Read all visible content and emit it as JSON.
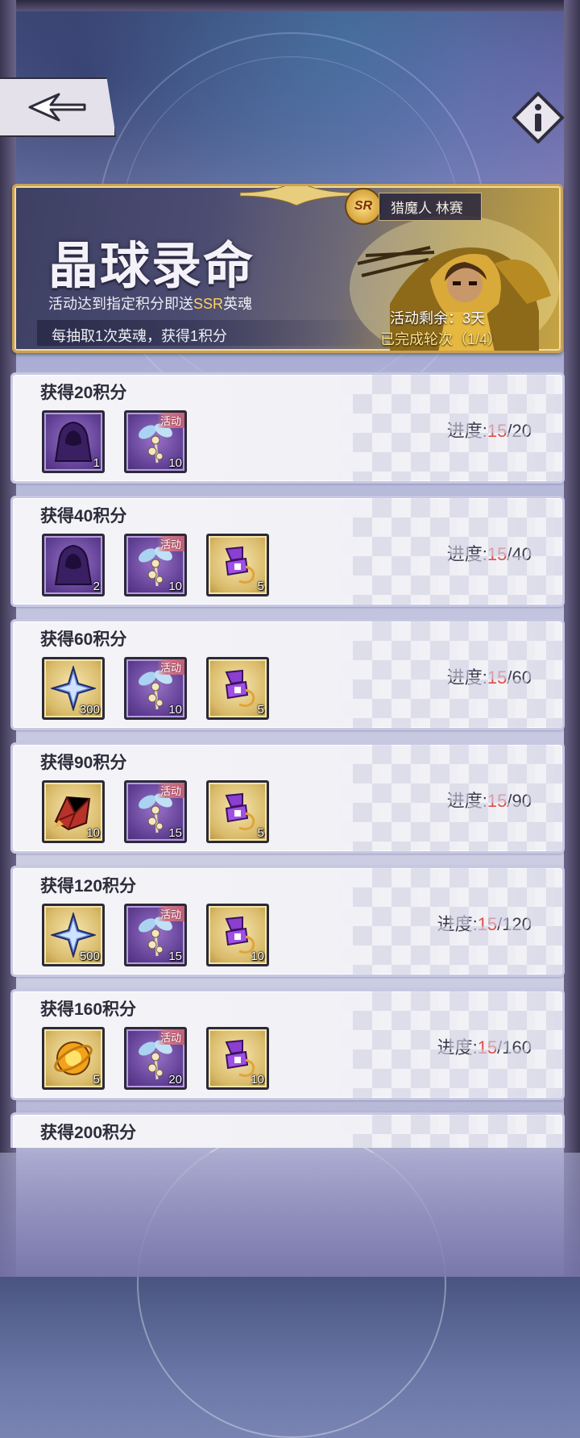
{
  "banner": {
    "title": "晶球录命",
    "desc_prefix": "活动达到指定积分即送",
    "desc_ssr": "SSR",
    "desc_suffix": "英魂",
    "rule": "每抽取1次英魂，获得1积分",
    "ssr_badge": "SR",
    "hero_name": "猎魔人 林赛",
    "remain": "活动剩余：3天",
    "completed": "已完成轮次（1/4）"
  },
  "progress_label": "进度:",
  "tasks": [
    {
      "title": "获得20积分",
      "current": "15",
      "target": "/20",
      "items": [
        {
          "icon": "hooded-figure-icon",
          "bg": "purple",
          "count": "1",
          "event": ""
        },
        {
          "icon": "event-token-icon",
          "bg": "purple",
          "count": "10",
          "event": "活动"
        }
      ]
    },
    {
      "title": "获得40积分",
      "current": "15",
      "target": "/40",
      "items": [
        {
          "icon": "hooded-figure-icon",
          "bg": "purple",
          "count": "2",
          "event": ""
        },
        {
          "icon": "event-token-icon",
          "bg": "purple",
          "count": "10",
          "event": "活动"
        },
        {
          "icon": "purple-ticket-icon",
          "bg": "gold",
          "count": "5",
          "event": ""
        }
      ]
    },
    {
      "title": "获得60积分",
      "current": "15",
      "target": "/60",
      "items": [
        {
          "icon": "blue-crystal-icon",
          "bg": "gold",
          "count": "300",
          "event": ""
        },
        {
          "icon": "event-token-icon",
          "bg": "purple",
          "count": "10",
          "event": "活动"
        },
        {
          "icon": "purple-ticket-icon",
          "bg": "gold",
          "count": "5",
          "event": ""
        }
      ]
    },
    {
      "title": "获得90积分",
      "current": "15",
      "target": "/90",
      "items": [
        {
          "icon": "red-gem-icon",
          "bg": "gold",
          "count": "10",
          "event": ""
        },
        {
          "icon": "event-token-icon",
          "bg": "purple",
          "count": "15",
          "event": "活动"
        },
        {
          "icon": "purple-ticket-icon",
          "bg": "gold",
          "count": "5",
          "event": ""
        }
      ]
    },
    {
      "title": "获得120积分",
      "current": "15",
      "target": "/120",
      "items": [
        {
          "icon": "blue-crystal-icon",
          "bg": "gold",
          "count": "500",
          "event": ""
        },
        {
          "icon": "event-token-icon",
          "bg": "purple",
          "count": "15",
          "event": "活动"
        },
        {
          "icon": "purple-ticket-icon",
          "bg": "gold",
          "count": "10",
          "event": ""
        }
      ]
    },
    {
      "title": "获得160积分",
      "current": "15",
      "target": "/160",
      "items": [
        {
          "icon": "gold-orb-icon",
          "bg": "gold",
          "count": "5",
          "event": ""
        },
        {
          "icon": "event-token-icon",
          "bg": "purple",
          "count": "20",
          "event": "活动"
        },
        {
          "icon": "purple-ticket-icon",
          "bg": "gold",
          "count": "10",
          "event": ""
        }
      ]
    },
    {
      "title": "获得200积分",
      "current": "",
      "target": "",
      "items": []
    }
  ]
}
